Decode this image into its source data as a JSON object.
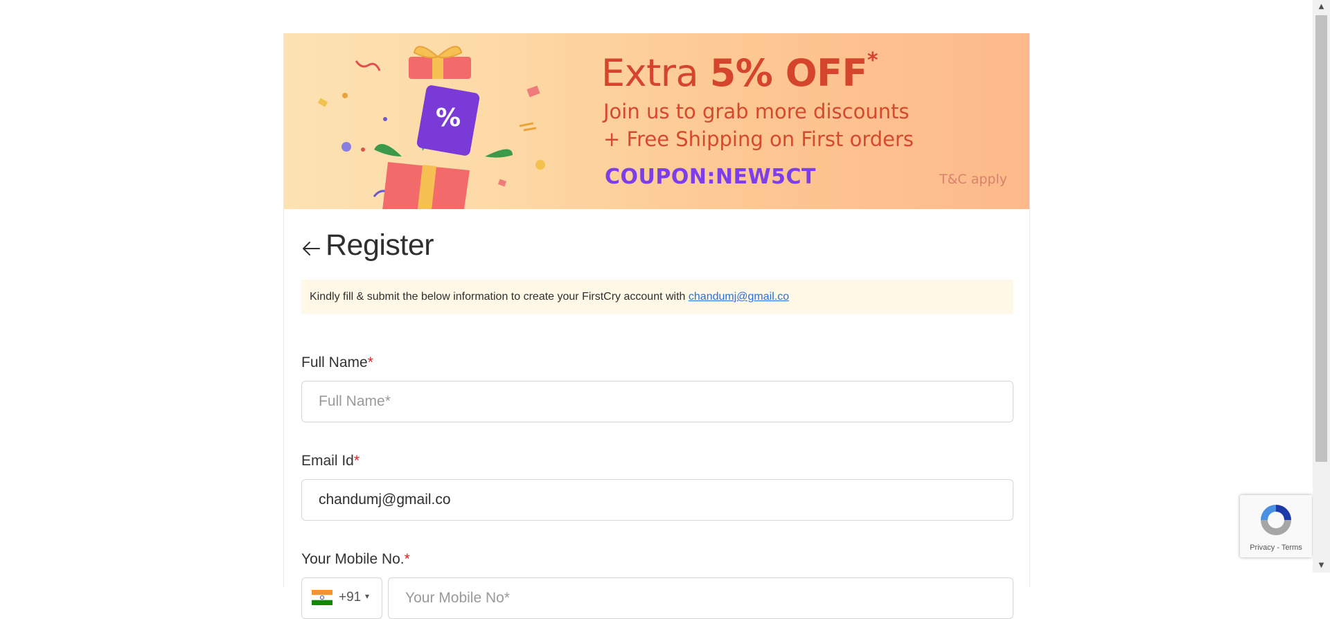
{
  "banner": {
    "headline_light": "Extra ",
    "headline_bold": "5% OFF",
    "headline_star": "*",
    "line2": "Join us to grab more discounts",
    "line3": "+ Free Shipping on First orders",
    "coupon": "COUPON:NEW5CT",
    "tnc": "T&C apply",
    "gift_symbol": "%",
    "colors": {
      "headline": "#d5442d",
      "coupon": "#7b3ee8",
      "background": "#fdc893"
    }
  },
  "header": {
    "title": "Register",
    "back_icon": "arrow-left-icon"
  },
  "notice": {
    "text": "Kindly fill & submit the below information to create your FirstCry account with ",
    "email_link": "chandumj@gmail.co"
  },
  "form": {
    "full_name": {
      "label": "Full Name",
      "required_mark": "*",
      "placeholder": "Full Name*",
      "value": ""
    },
    "email": {
      "label": "Email Id",
      "required_mark": "*",
      "value": "chandumj@gmail.co"
    },
    "mobile": {
      "label": "Your Mobile No.",
      "required_mark": "*",
      "country_code": "+91",
      "country_flag": "india-flag-icon",
      "caret": "▾",
      "placeholder": "Your Mobile No*",
      "value": ""
    }
  },
  "recaptcha": {
    "privacy": "Privacy",
    "separator": " - ",
    "terms": "Terms"
  },
  "scrollbar": {
    "up": "▲",
    "down": "▼"
  }
}
